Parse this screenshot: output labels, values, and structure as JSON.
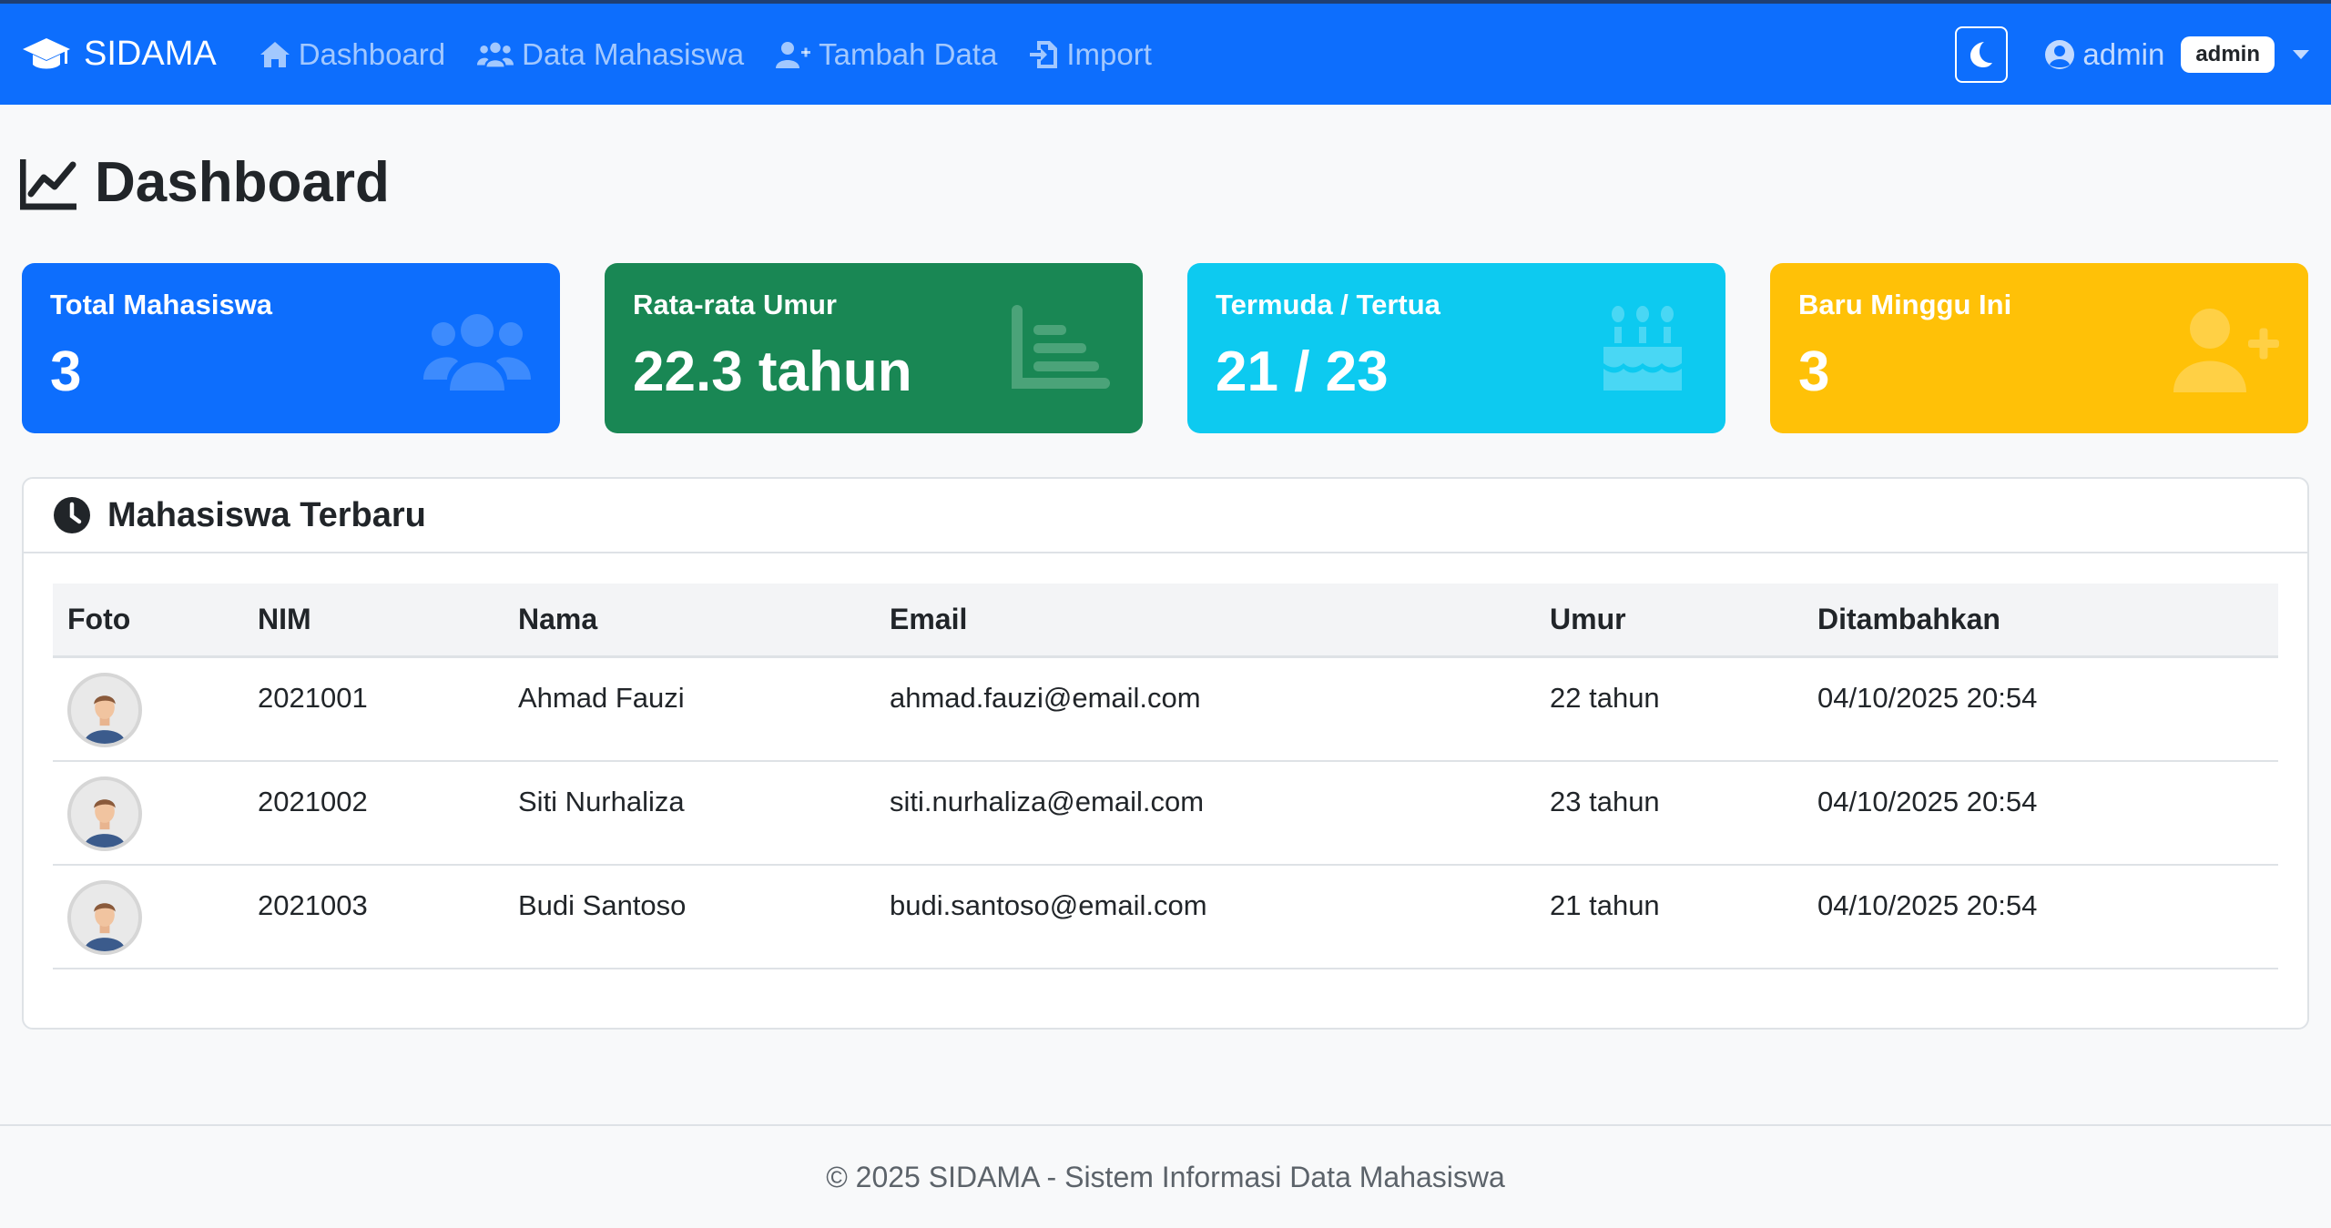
{
  "navbar": {
    "brand": "SIDAMA",
    "links": [
      {
        "label": "Dashboard",
        "icon": "home-icon"
      },
      {
        "label": "Data Mahasiswa",
        "icon": "users-icon"
      },
      {
        "label": "Tambah Data",
        "icon": "user-plus-icon"
      },
      {
        "label": "Import",
        "icon": "file-import-icon"
      }
    ],
    "theme_toggle_icon": "moon-icon",
    "user": {
      "name": "admin",
      "role_badge": "admin"
    }
  },
  "page": {
    "title": "Dashboard",
    "title_icon": "line-chart-icon"
  },
  "stats": [
    {
      "label": "Total Mahasiswa",
      "value": "3",
      "icon": "users-icon",
      "color": "#0d6efd"
    },
    {
      "label": "Rata-rata Umur",
      "value": "22.3 tahun",
      "icon": "chart-bar-icon",
      "color": "#198754"
    },
    {
      "label": "Termuda / Tertua",
      "value": "21 / 23",
      "icon": "birthday-cake-icon",
      "color": "#0dcaf0"
    },
    {
      "label": "Baru Minggu Ini",
      "value": "3",
      "icon": "user-plus-icon",
      "color": "#ffc107"
    }
  ],
  "recent": {
    "title": "Mahasiswa Terbaru",
    "title_icon": "clock-icon",
    "columns": [
      "Foto",
      "NIM",
      "Nama",
      "Email",
      "Umur",
      "Ditambahkan"
    ],
    "rows": [
      {
        "nim": "2021001",
        "nama": "Ahmad Fauzi",
        "email": "ahmad.fauzi@email.com",
        "umur": "22 tahun",
        "ditambahkan": "04/10/2025 20:54"
      },
      {
        "nim": "2021002",
        "nama": "Siti Nurhaliza",
        "email": "siti.nurhaliza@email.com",
        "umur": "23 tahun",
        "ditambahkan": "04/10/2025 20:54"
      },
      {
        "nim": "2021003",
        "nama": "Budi Santoso",
        "email": "budi.santoso@email.com",
        "umur": "21 tahun",
        "ditambahkan": "04/10/2025 20:54"
      }
    ]
  },
  "footer": {
    "text": "© 2025 SIDAMA - Sistem Informasi Data Mahasiswa"
  }
}
